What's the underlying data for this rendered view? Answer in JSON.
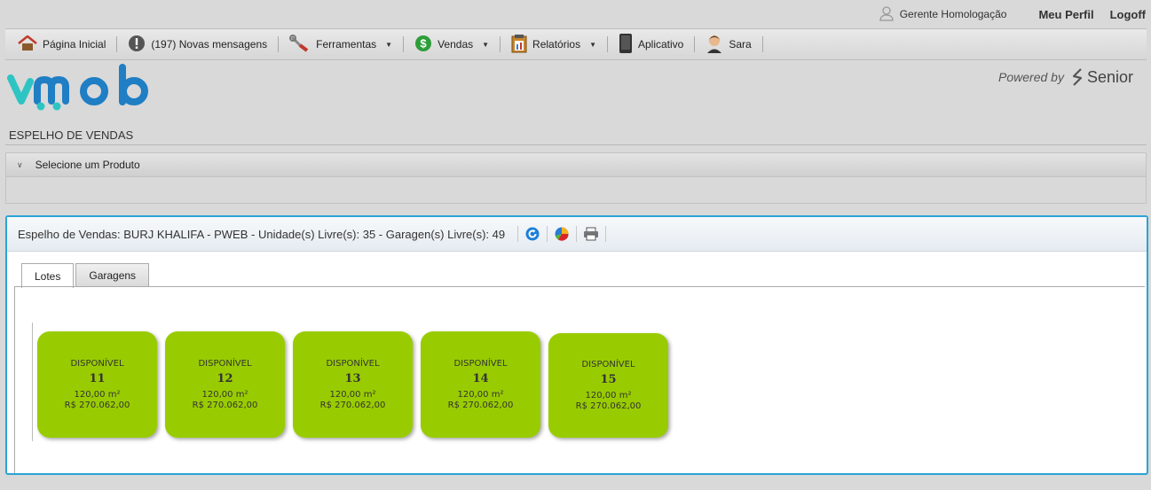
{
  "topbar": {
    "user_name": "Gerente Homologação",
    "profile": "Meu Perfil",
    "logoff": "Logoff"
  },
  "menu": [
    {
      "label": "Página Inicial",
      "icon": "home-icon"
    },
    {
      "label": "(197) Novas mensagens",
      "icon": "alert-icon"
    },
    {
      "label": "Ferramentas",
      "icon": "tools-icon"
    },
    {
      "label": "Vendas",
      "icon": "dollar-icon"
    },
    {
      "label": "Relatórios",
      "icon": "clipboard-icon"
    },
    {
      "label": "Aplicativo",
      "icon": "phone-icon"
    },
    {
      "label": "Sara",
      "icon": "avatar-icon"
    }
  ],
  "brand": {
    "logo_text": "viimob",
    "powered_by": "Powered by",
    "senior": "Senior"
  },
  "page_title": "ESPELHO DE VENDAS",
  "selector": {
    "label": "Selecione um Produto"
  },
  "panel": {
    "title": "Espelho de Vendas: BURJ KHALIFA - PWEB - Unidade(s) Livre(s): 35 - Garagen(s) Livre(s): 49",
    "tabs": [
      "Lotes",
      "Garagens"
    ],
    "units": [
      {
        "status": "DISPONÍVEL",
        "number": "11",
        "area": "120,00 m²",
        "price": "R$ 270.062,00"
      },
      {
        "status": "DISPONÍVEL",
        "number": "12",
        "area": "120,00 m²",
        "price": "R$ 270.062,00"
      },
      {
        "status": "DISPONÍVEL",
        "number": "13",
        "area": "120,00 m²",
        "price": "R$ 270.062,00"
      },
      {
        "status": "DISPONÍVEL",
        "number": "14",
        "area": "120,00 m²",
        "price": "R$ 270.062,00"
      },
      {
        "status": "DISPONÍVEL",
        "number": "15",
        "area": "120,00 m²",
        "price": "R$ 270.062,00"
      }
    ]
  },
  "colors": {
    "unit_available": "#99cc00",
    "panel_border": "#2aa3d6",
    "logo_teal": "#2ec4c4",
    "logo_blue": "#1f7ec4"
  }
}
